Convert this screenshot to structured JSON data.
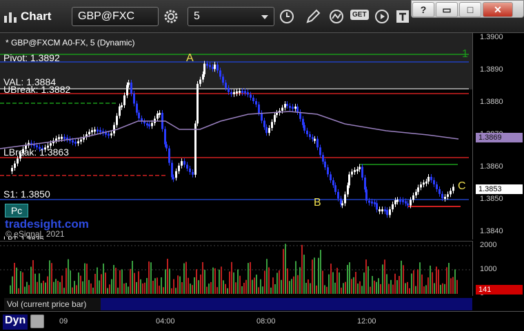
{
  "toolbar": {
    "title": "Chart",
    "symbol": "GBP@FXC",
    "interval": "5",
    "get_label": "GET"
  },
  "window": {
    "help": "?",
    "restore": "▭",
    "maximize": "□",
    "close": "✕"
  },
  "chart": {
    "title": "* GBP@FXCM A0-FX, 5 (Dynamic)",
    "levels": {
      "pivot": "Pivot: 1.3892",
      "val": "VAL: 1.3884",
      "ubreak": "UBreak: 1.3882",
      "lbreak": "LBreak: 1.3863",
      "s1": "S1: 1.3850",
      "lpt": "LPT: 1.3835"
    },
    "points": {
      "a": "A",
      "b": "B",
      "c": "C",
      "one": "1"
    },
    "badge": "Pc",
    "watermark": "tradesight.com",
    "copyright": "© eSignal, 2021"
  },
  "price_axis": {
    "ticks": [
      "1.3900",
      "1.3890",
      "1.3880",
      "1.3870",
      "1.3860",
      "1.3850",
      "1.3840"
    ],
    "ma_tag": "1.3869",
    "last_tag": "1.3853"
  },
  "volume": {
    "label": "Vol (current price bar)",
    "ticks": [
      "2000",
      "1000",
      "0"
    ],
    "last_tag": "141"
  },
  "time_axis": {
    "dyn_label": "Dyn",
    "ticks": [
      "09",
      "04:00",
      "08:00",
      "12:00"
    ]
  },
  "colors": {
    "up_candle": "#ffffff",
    "down_candle": "#2a3cff",
    "moving_average": "#9a80c0",
    "pivot_line": "#1a9a1a",
    "resistance_line": "#d02020",
    "support_line": "#2040c0",
    "volume_up": "#3aa040",
    "volume_down": "#c02020",
    "ma_tag_bg": "#9a80c0"
  }
}
